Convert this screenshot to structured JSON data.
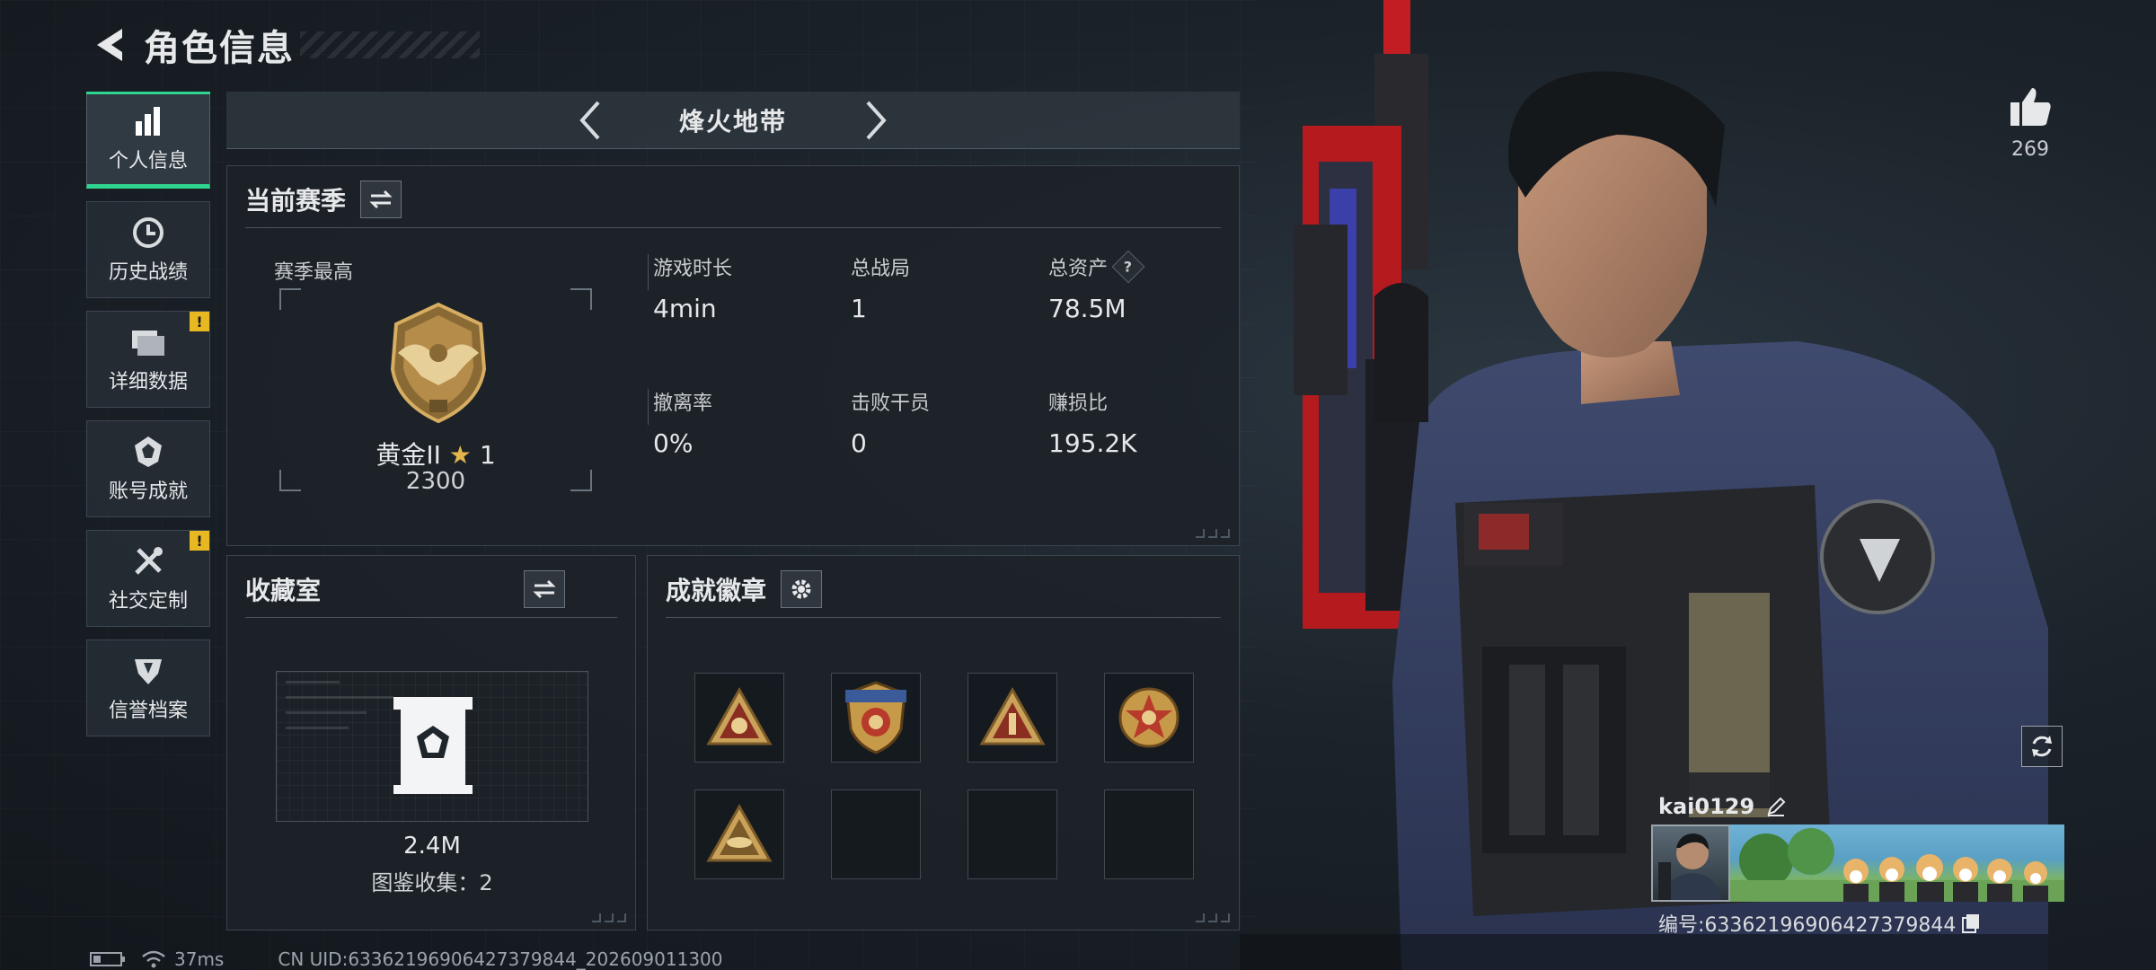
{
  "header": {
    "title": "角色信息"
  },
  "sidebar": {
    "items": [
      {
        "label": "个人信息",
        "icon": "bar-chart-icon",
        "active": true,
        "alert": ""
      },
      {
        "label": "历史战绩",
        "icon": "clock-icon",
        "active": false,
        "alert": ""
      },
      {
        "label": "详细数据",
        "icon": "folder-icon",
        "active": false,
        "alert": "!"
      },
      {
        "label": "账号成就",
        "icon": "achievement-icon",
        "active": false,
        "alert": ""
      },
      {
        "label": "社交定制",
        "icon": "tools-icon",
        "active": false,
        "alert": "!"
      },
      {
        "label": "信誉档案",
        "icon": "credit-icon",
        "active": false,
        "alert": ""
      }
    ]
  },
  "mode": {
    "name": "烽火地带"
  },
  "season": {
    "title": "当前赛季",
    "best_label": "赛季最高",
    "rank_name": "黄金II",
    "rank_star": "★",
    "rank_stars": "1",
    "rank_score": "2300",
    "stats": [
      {
        "label": "游戏时长",
        "value": "4min"
      },
      {
        "label": "总战局",
        "value": "1"
      },
      {
        "label": "总资产",
        "value": "78.5M",
        "help": "?"
      },
      {
        "label": "撤离率",
        "value": "0%"
      },
      {
        "label": "击败干员",
        "value": "0"
      },
      {
        "label": "赚损比",
        "value": "195.2K"
      }
    ]
  },
  "collection": {
    "title": "收藏室",
    "value": "2.4M",
    "count_text": "图鉴收集：2"
  },
  "badges": {
    "title": "成就徽章",
    "slots": [
      {
        "icon": "badge-triangle-55-icon",
        "filled": true
      },
      {
        "icon": "badge-shield-icon",
        "filled": true
      },
      {
        "icon": "badge-triangle-1-icon",
        "filled": true
      },
      {
        "icon": "badge-star-icon",
        "filled": true
      },
      {
        "icon": "badge-triangle-ufo-icon",
        "filled": true
      },
      {
        "icon": "",
        "filled": false
      },
      {
        "icon": "",
        "filled": false
      },
      {
        "icon": "",
        "filled": false
      }
    ]
  },
  "like": {
    "count": "269"
  },
  "player": {
    "name": "kai0129",
    "id_text": "编号:63362196906427379844"
  },
  "status": {
    "ping": "37ms",
    "uid": "CN UID:63362196906427379844_202609011300"
  },
  "colors": {
    "accent": "#2fd58f",
    "alert": "#e7b822",
    "gold": "#c89a4a"
  }
}
